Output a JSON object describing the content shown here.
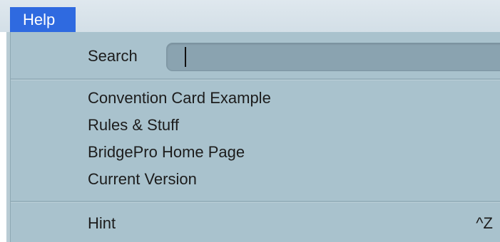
{
  "menubar": {
    "title": "Help"
  },
  "menu": {
    "search": {
      "label": "Search",
      "value": ""
    },
    "items": [
      {
        "label": "Convention Card Example"
      },
      {
        "label": "Rules & Stuff"
      },
      {
        "label": "BridgePro Home Page"
      },
      {
        "label": "Current Version"
      }
    ],
    "hint": {
      "label": "Hint",
      "shortcut": "^Z"
    }
  },
  "colors": {
    "menu_highlight": "#2f6ae0",
    "menu_background": "#a9c2cd",
    "search_field": "#8aa3b0"
  }
}
